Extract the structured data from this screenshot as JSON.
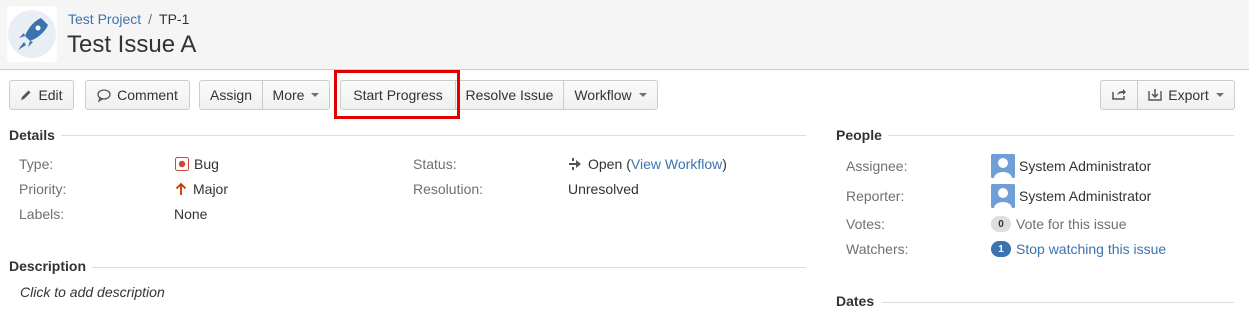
{
  "header": {
    "project": "Test Project",
    "separator": "/",
    "issue_key": "TP-1",
    "title": "Test Issue A"
  },
  "toolbar": {
    "edit": "Edit",
    "comment": "Comment",
    "assign": "Assign",
    "more": "More",
    "start_progress": "Start Progress",
    "resolve_issue": "Resolve Issue",
    "workflow": "Workflow",
    "export": "Export"
  },
  "details": {
    "heading": "Details",
    "type_label": "Type:",
    "type_value": "Bug",
    "priority_label": "Priority:",
    "priority_value": "Major",
    "labels_label": "Labels:",
    "labels_value": "None",
    "status_label": "Status:",
    "status_value": "Open",
    "view_workflow_open": "(",
    "view_workflow": "View Workflow",
    "view_workflow_close": ")",
    "resolution_label": "Resolution:",
    "resolution_value": "Unresolved"
  },
  "description": {
    "heading": "Description",
    "placeholder": "Click to add description"
  },
  "people": {
    "heading": "People",
    "assignee_label": "Assignee:",
    "assignee_value": "System Administrator",
    "reporter_label": "Reporter:",
    "reporter_value": "System Administrator",
    "votes_label": "Votes:",
    "votes_count": "0",
    "votes_link": "Vote for this issue",
    "watchers_label": "Watchers:",
    "watchers_count": "1",
    "watchers_link": "Stop watching this issue"
  },
  "dates": {
    "heading": "Dates"
  },
  "colors": {
    "link": "#3b73af",
    "highlight": "#e00000",
    "bug": "#d04437",
    "priority": "#cc3300"
  }
}
